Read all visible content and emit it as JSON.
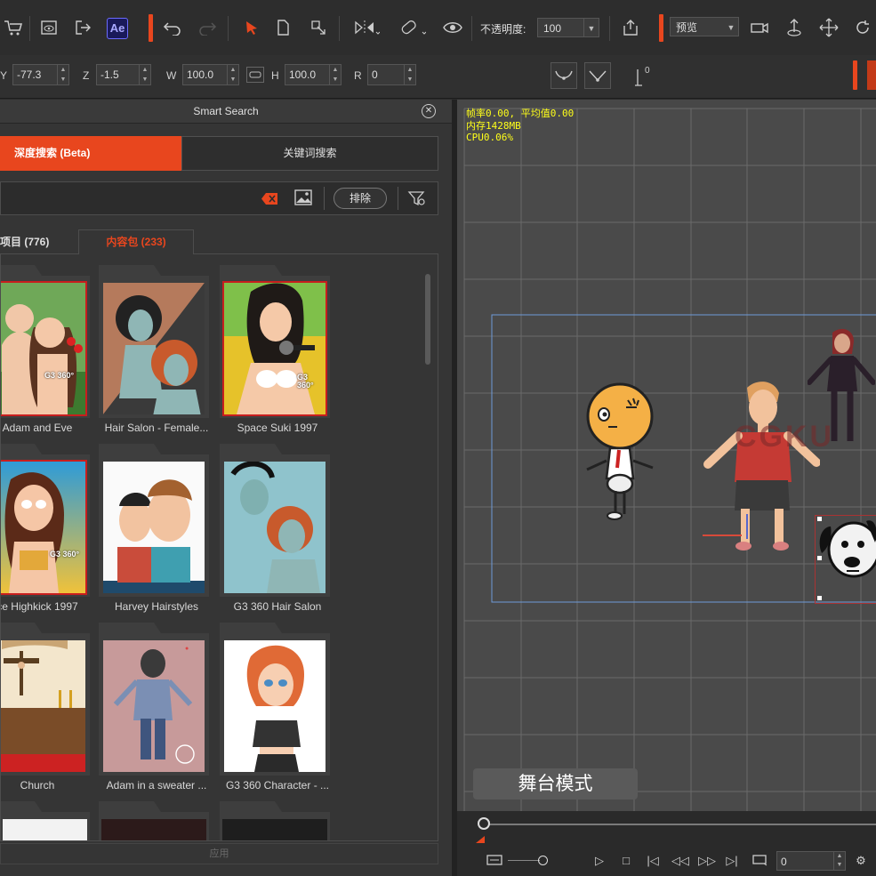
{
  "toolbar": {
    "ae_label": "Ae",
    "opacity_label": "不透明度:",
    "opacity_value": "100",
    "preview_value": "预览"
  },
  "transform": {
    "y_label": "Y",
    "y_value": "-77.3",
    "z_label": "Z",
    "z_value": "-1.5",
    "w_label": "W",
    "w_value": "100.0",
    "h_label": "H",
    "h_value": "100.0",
    "r_label": "R",
    "r_value": "0",
    "anchor_value": "0"
  },
  "panel": {
    "title": "Smart Search",
    "tab_deep": "深度搜索 (Beta)",
    "tab_keyword": "关键词搜索",
    "exclude_label": "排除",
    "subtab_items": "项目 (776)",
    "subtab_packs": "内容包 (233)",
    "apply_label": "应用",
    "cards": [
      {
        "caption": "Adam and Eve"
      },
      {
        "caption": "Hair Salon - Female..."
      },
      {
        "caption": "Space Suki 1997"
      },
      {
        "caption": "ce Highkick 1997"
      },
      {
        "caption": "Harvey Hairstyles"
      },
      {
        "caption": "G3 360 Hair Salon"
      },
      {
        "caption": "Church"
      },
      {
        "caption": "Adam in a sweater ..."
      },
      {
        "caption": "G3 360 Character - ..."
      }
    ],
    "badge_text": "G3 360°"
  },
  "viewport": {
    "stat_fps": "帧率0.00, 平均值0.00",
    "stat_mem": "内存1428MB",
    "stat_cpu": "CPU0.06%",
    "stage_mode": "舞台模式",
    "watermark": "CGKU"
  },
  "timeline": {
    "frame_value": "0"
  },
  "colors": {
    "accent": "#e8461e",
    "selection_red": "#c81e1e",
    "viewport_bg": "#474747",
    "stat_text": "#ffff1a"
  }
}
